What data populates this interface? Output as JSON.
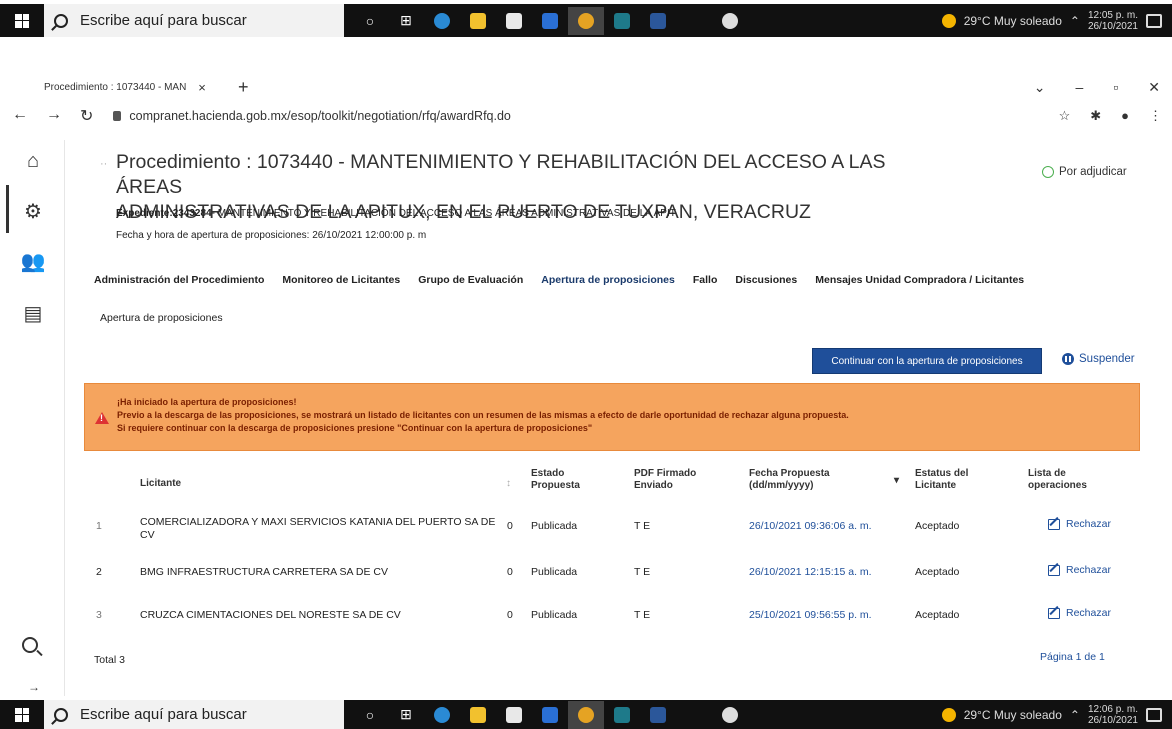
{
  "taskbar": {
    "search_placeholder": "Escribe aquí para buscar",
    "weather": "29°C  Muy soleado",
    "time_top": "12:05 p. m.",
    "time_bottom": "12:06 p. m.",
    "date": "26/10/2021"
  },
  "browser": {
    "tab_title": "Procedimiento : 1073440 - MAN",
    "url": "compranet.hacienda.gob.mx/esop/toolkit/negotiation/rfq/awardRfq.do"
  },
  "page": {
    "title_line1": "Procedimiento : 1073440 - MANTENIMIENTO Y REHABILITACIÓN DEL ACCESO A LAS ÁREAS",
    "title_line2": "ADMINISTRATIVAS DE LA APITUX, EN EL PUERTO DE TUXPAN, VERACRUZ",
    "status": "Por adjudicar",
    "expediente_label": "Expediente:",
    "expediente_number": "2343284",
    "expediente_desc": "- MANTENIMIENTO Y REHABILITACIÓN DEL ACCESO A LAS ÁREAS ADMINISTRATIVAS DE LA APIT",
    "fecha_apertura": "Fecha y hora de apertura de proposiciones: 26/10/2021 12:00:00 p. m",
    "tabs": [
      {
        "label": "Administración del Procedimiento"
      },
      {
        "label": "Monitoreo de Licitantes"
      },
      {
        "label": "Grupo de Evaluación"
      },
      {
        "label": "Apertura de proposiciones"
      },
      {
        "label": "Fallo"
      },
      {
        "label": "Discusiones"
      },
      {
        "label": "Mensajes Unidad Compradora / Licitantes"
      }
    ],
    "subtitle": "Apertura de proposiciones",
    "continue_button": "Continuar con la apertura de proposiciones",
    "suspend_button": "Suspender",
    "alert": {
      "line1": "¡Ha iniciado la apertura de proposiciones!",
      "line2": "Previo a la descarga de las proposiciones, se mostrará un listado de licitantes con un resumen de las mismas a efecto de darle oportunidad de rechazar alguna propuesta.",
      "line3": "Si requiere continuar con la descarga de proposiciones presione \"Continuar con la apertura de proposiciones\""
    },
    "table": {
      "headers": {
        "licitante": "Licitante",
        "sort_col": "↕",
        "estado_1": "Estado",
        "estado_2": "Propuesta",
        "pdf_1": "PDF Firmado",
        "pdf_2": "Enviado",
        "fecha_1": "Fecha Propuesta",
        "fecha_2": "(dd/mm/yyyy)",
        "estatus_1": "Estatus del",
        "estatus_2": "Licitante",
        "lista_1": "Lista de",
        "lista_2": "operaciones"
      },
      "rows": [
        {
          "num": "1",
          "licitante": "COMERCIALIZADORA Y MAXI SERVICIOS KATANIA DEL PUERTO SA DE CV",
          "count": "0",
          "estado": "Publicada",
          "pdf": "T E",
          "fecha": "26/10/2021 09:36:06 a. m.",
          "estatus": "Aceptado",
          "accion": "Rechazar"
        },
        {
          "num": "2",
          "licitante": "BMG INFRAESTRUCTURA CARRETERA SA DE CV",
          "count": "0",
          "estado": "Publicada",
          "pdf": "T E",
          "fecha": "26/10/2021 12:15:15 a. m.",
          "estatus": "Aceptado",
          "accion": "Rechazar"
        },
        {
          "num": "3",
          "licitante": "CRUZCA CIMENTACIONES DEL NORESTE SA DE CV",
          "count": "0",
          "estado": "Publicada",
          "pdf": "T E",
          "fecha": "25/10/2021 09:56:55 p. m.",
          "estatus": "Aceptado",
          "accion": "Rechazar"
        }
      ],
      "total": "Total 3",
      "pagination": "Página 1 de 1"
    }
  }
}
